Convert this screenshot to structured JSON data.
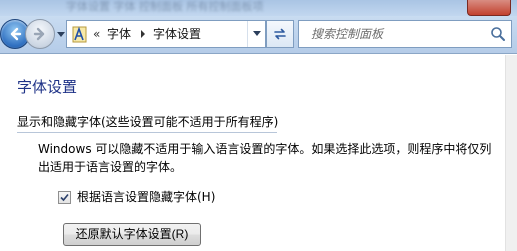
{
  "window": {
    "title_blurred": "字体设置 字体 控制面板 所有控制面板项"
  },
  "navbar": {
    "back_icon": "back-arrow-icon",
    "forward_icon": "forward-arrow-icon",
    "address": {
      "overflow_chevron": "«",
      "crumbs": [
        "字体",
        "字体设置"
      ]
    },
    "refresh_icon": "refresh-icon",
    "search": {
      "placeholder": "搜索控制面板",
      "icon": "search-icon"
    }
  },
  "content": {
    "page_title": "字体设置",
    "section_heading": "显示和隐藏字体(这些设置可能不适用于所有程序)",
    "description": "Windows 可以隐藏不适用于输入语言设置的字体。如果选择此选项，则程序中将仅列出适用于语言设置的字体。",
    "checkbox": {
      "label": "根据语言设置隐藏字体(H)",
      "checked": true
    },
    "restore_button": "还原默认字体设置(R)"
  },
  "colors": {
    "title_blue": "#1e3287",
    "chrome_blue": "#bcd2ec"
  }
}
